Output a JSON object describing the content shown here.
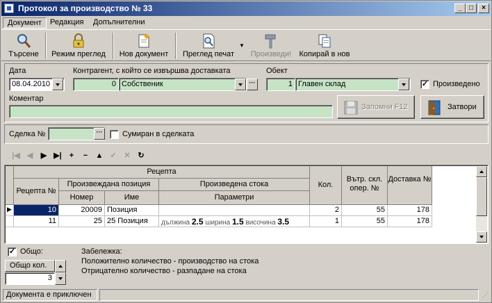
{
  "window": {
    "title": "Протокол за производство № 33",
    "controls": {
      "minimize": "_",
      "maximize": "□",
      "close": "×"
    }
  },
  "menu": {
    "items": [
      "Документ",
      "Редакция",
      "Допълнителни"
    ]
  },
  "toolbar": {
    "search": "Търсене",
    "view_mode": "Режим преглед",
    "new_document": "Нов документ",
    "print_preview": "Преглед печат",
    "produce": "Произведи!",
    "copy_to_new": "Копирай в нов"
  },
  "form": {
    "date_label": "Дата",
    "date_value": "08.04.2010",
    "contractor_label": "Контрагент, с който се извършва доставката",
    "contractor_code": "0",
    "contractor_name": "Собственик",
    "object_label": "Обект",
    "object_code": "1",
    "object_name": "Главен склад",
    "produced_label": "Произведено",
    "produced_checked": true,
    "comment_label": "Коментар",
    "comment_value": "",
    "save_button": "Запомни  F12",
    "close_button": "Затвори"
  },
  "deal": {
    "label": "Сделка №",
    "value": "",
    "summed_label": "Сумиран в сделката",
    "summed_checked": false
  },
  "navigator": [
    "|◀",
    "◀",
    "▶",
    "▶|",
    "+",
    "−",
    "▲",
    "✓",
    "✕",
    "↻"
  ],
  "grid": {
    "headers": {
      "group": "Рецепта",
      "recipe_no": "Рецепта №",
      "produced_item": "Произвеждана позиция",
      "number": "Номер",
      "name": "Име",
      "produced_goods": "Произведена стока",
      "parameters": "Параметри",
      "qty": "Кол.",
      "internal_op": "Вътр. скл. опер. №",
      "delivery_no": "Доставка №"
    },
    "rows": [
      {
        "recipe": "10",
        "number": "20009",
        "name": "Позиция",
        "params": "",
        "qty": "2",
        "op": "55",
        "delivery": "178"
      },
      {
        "recipe": "11",
        "number": "25",
        "name": "25 Позиция",
        "params_parts": [
          "дължина",
          "2.5",
          "ширина",
          "1.5",
          "височина",
          "3.5"
        ],
        "qty": "1",
        "op": "55",
        "delivery": "178"
      }
    ]
  },
  "bottom": {
    "total_label": "Общо:",
    "total_checked": true,
    "total_qty_label": "Общо кол.",
    "total_qty_value": "3",
    "note_title": "Забележка:",
    "note_line1": "Положително количество - производство на стока",
    "note_line2": "Отрицателно количество - разпадане на стока"
  },
  "status": {
    "text": "Документа е приключен"
  }
}
